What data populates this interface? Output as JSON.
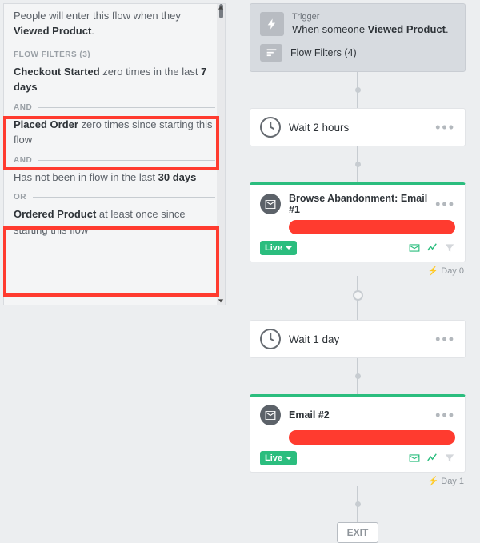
{
  "sidebar": {
    "entry_prefix": "People will enter this flow when they ",
    "entry_event": "Viewed Product",
    "entry_suffix": ".",
    "filters_label": "FLOW FILTERS (3)",
    "filter1_a": "Checkout Started",
    "filter1_b": " zero times in the last ",
    "filter1_c": "7 days",
    "and": "AND",
    "filter2_a": "Placed Order",
    "filter2_b": " zero times since starting this flow",
    "filter3_a": "Has not been in flow in the last ",
    "filter3_b": "30 days",
    "or": "OR",
    "filter4_a": "Ordered Product",
    "filter4_b": " at least once since starting this flow"
  },
  "trigger": {
    "label": "Trigger",
    "text_prefix": "When someone ",
    "text_event": "Viewed Product",
    "text_suffix": ".",
    "flow_filters": "Flow Filters (4)"
  },
  "wait1": "Wait 2 hours",
  "wait2": "Wait 1 day",
  "email1": {
    "title": "Browse Abandonment: Email #1",
    "status": "Live",
    "day": "Day 0"
  },
  "email2": {
    "title": "Email #2",
    "status": "Live",
    "day": "Day 1"
  },
  "exit": "EXIT"
}
